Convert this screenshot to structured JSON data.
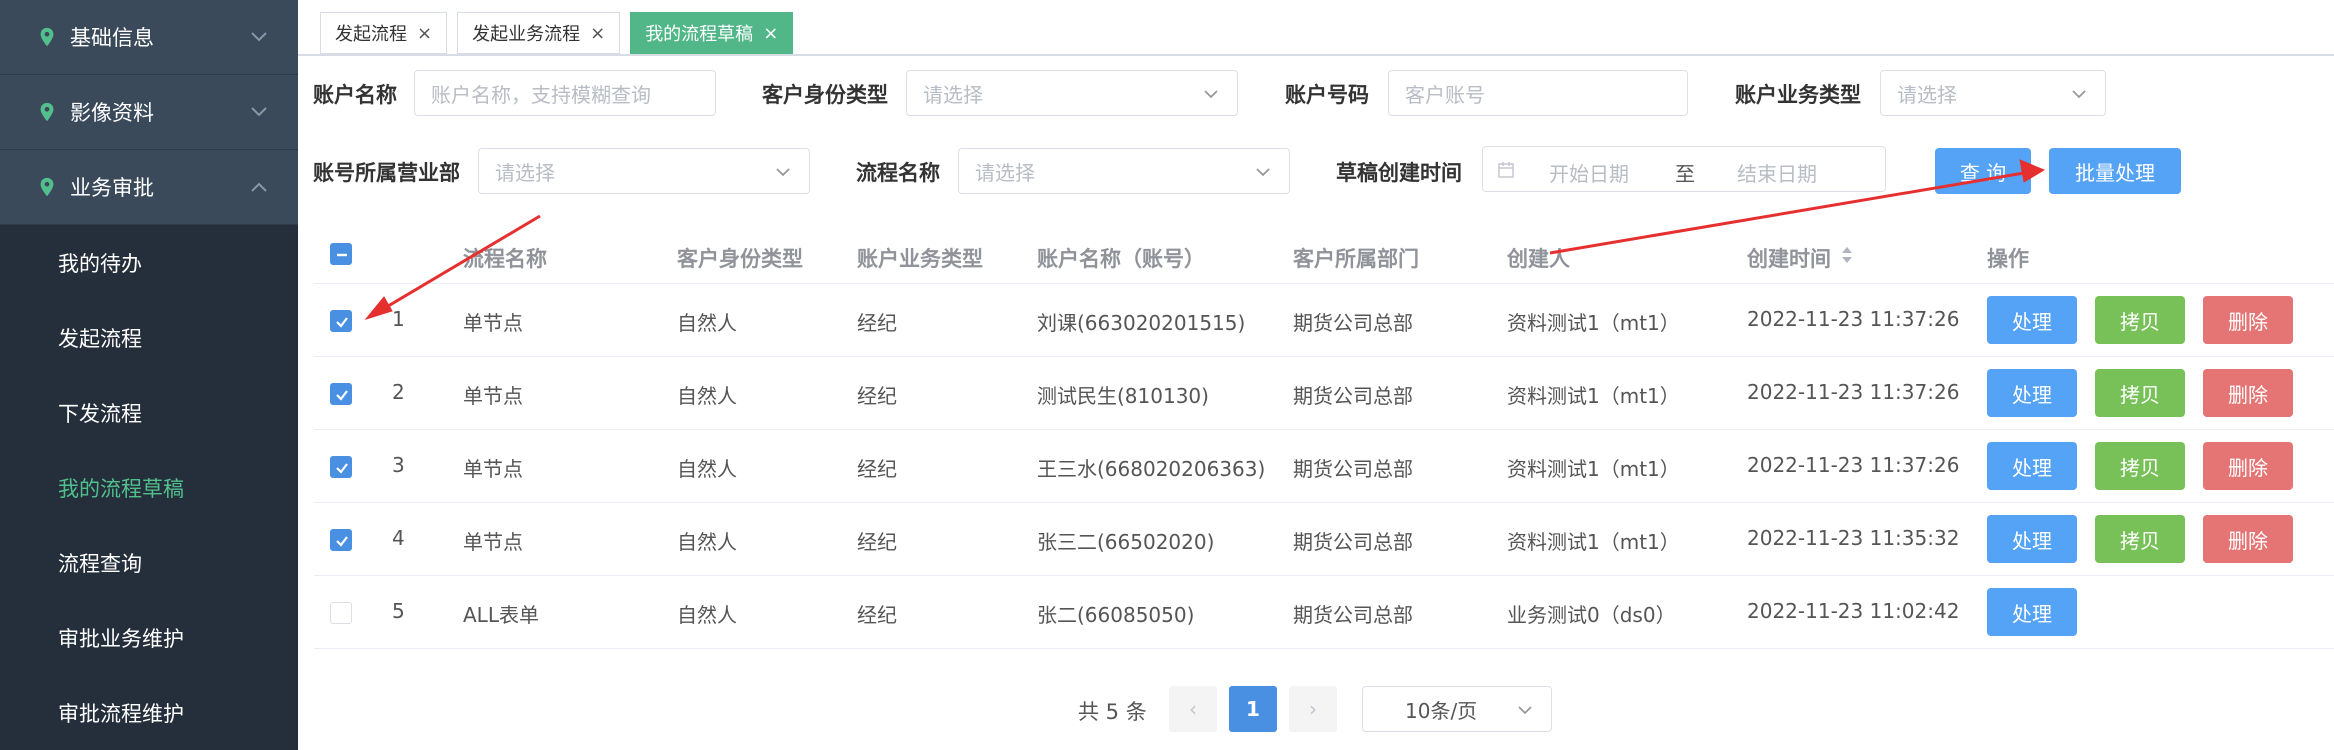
{
  "sidebar": {
    "groups": [
      {
        "label": "基础信息"
      },
      {
        "label": "影像资料"
      },
      {
        "label": "业务审批"
      }
    ],
    "items": [
      {
        "label": "我的待办"
      },
      {
        "label": "发起流程"
      },
      {
        "label": "下发流程"
      },
      {
        "label": "我的流程草稿"
      },
      {
        "label": "流程查询"
      },
      {
        "label": "审批业务维护"
      },
      {
        "label": "审批流程维护"
      }
    ],
    "active_color": "#52c08d"
  },
  "tabs": [
    {
      "label": "发起流程",
      "close": "×"
    },
    {
      "label": "发起业务流程",
      "close": "×"
    },
    {
      "label": "我的流程草稿",
      "close": "×"
    }
  ],
  "filters": {
    "account_name": {
      "label": "账户名称",
      "placeholder": "账户名称，支持模糊查询"
    },
    "id_type": {
      "label": "客户身份类型",
      "placeholder": "请选择"
    },
    "account_no": {
      "label": "账户号码",
      "placeholder": "客户账号"
    },
    "biz_type": {
      "label": "账户业务类型",
      "placeholder": "请选择"
    },
    "branch": {
      "label": "账号所属营业部",
      "placeholder": "请选择"
    },
    "flow_name": {
      "label": "流程名称",
      "placeholder": "请选择"
    },
    "created": {
      "label": "草稿创建时间",
      "start": "开始日期",
      "sep": "至",
      "end": "结束日期"
    },
    "query_label": "查 询",
    "batch_label": "批量处理"
  },
  "table": {
    "headers": {
      "flow_name": "流程名称",
      "id_type": "客户身份类型",
      "biz_type": "账户业务类型",
      "account": "账户名称（账号）",
      "dept": "客户所属部门",
      "creator": "创建人",
      "created": "创建时间",
      "ops": "操作"
    },
    "rows": [
      {
        "checked": true,
        "no": "1",
        "flow": "单节点",
        "id_type": "自然人",
        "biz": "经纪",
        "account": "刘课(663020201515)",
        "dept": "期货公司总部",
        "creator": "资料测试1（mt1）",
        "time": "2022-11-23 11:37:26"
      },
      {
        "checked": true,
        "no": "2",
        "flow": "单节点",
        "id_type": "自然人",
        "biz": "经纪",
        "account": "测试民生(810130)",
        "dept": "期货公司总部",
        "creator": "资料测试1（mt1）",
        "time": "2022-11-23 11:37:26"
      },
      {
        "checked": true,
        "no": "3",
        "flow": "单节点",
        "id_type": "自然人",
        "biz": "经纪",
        "account": "王三水(668020206363)",
        "dept": "期货公司总部",
        "creator": "资料测试1（mt1）",
        "time": "2022-11-23 11:37:26"
      },
      {
        "checked": true,
        "no": "4",
        "flow": "单节点",
        "id_type": "自然人",
        "biz": "经纪",
        "account": "张三二(66502020)",
        "dept": "期货公司总部",
        "creator": "资料测试1（mt1）",
        "time": "2022-11-23 11:35:32"
      },
      {
        "checked": false,
        "no": "5",
        "flow": "ALL表单",
        "id_type": "自然人",
        "biz": "经纪",
        "account": "张二(66085050)",
        "dept": "期货公司总部",
        "creator": "业务测试0（ds0）",
        "time": "2022-11-23 11:02:42"
      }
    ],
    "actions": {
      "process": "处理",
      "copy": "拷贝",
      "delete": "删除"
    }
  },
  "pagination": {
    "total": "共 5 条",
    "prev": "‹",
    "page": "1",
    "next": "›",
    "page_size": "10条/页"
  },
  "colors": {
    "accent_blue": "#55a3f6",
    "copy_green": "#78c159",
    "delete_red": "#e57575",
    "annotation_red": "#e63030"
  }
}
